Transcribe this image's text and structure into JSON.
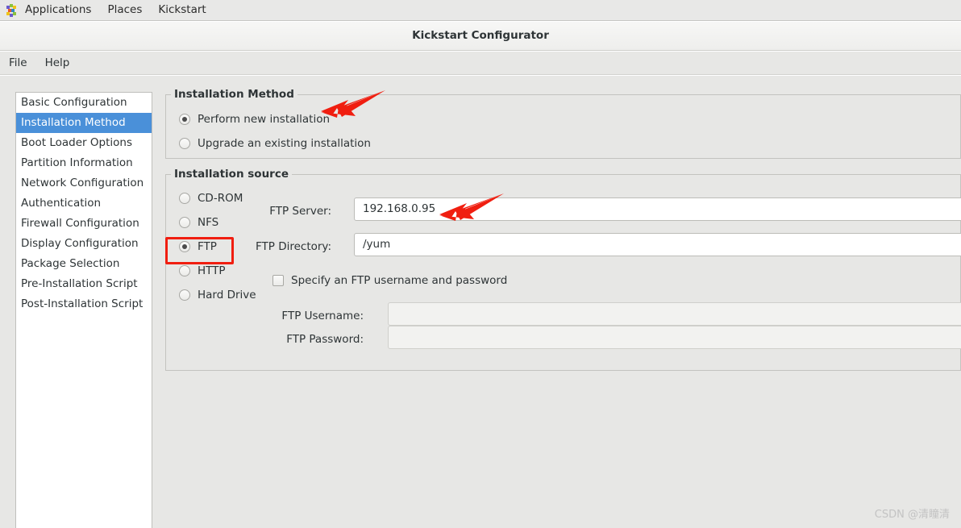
{
  "gnome_panel": {
    "logo_icon": "fedora-activities-icon",
    "items": [
      {
        "label": "Applications",
        "name": "panel-applications"
      },
      {
        "label": "Places",
        "name": "panel-places"
      },
      {
        "label": "Kickstart",
        "name": "panel-kickstart"
      }
    ]
  },
  "window": {
    "title": "Kickstart Configurator"
  },
  "menubar": {
    "items": [
      {
        "label": "File",
        "name": "menu-file"
      },
      {
        "label": "Help",
        "name": "menu-help"
      }
    ]
  },
  "sidebar": {
    "items": [
      {
        "label": "Basic Configuration",
        "selected": false
      },
      {
        "label": "Installation Method",
        "selected": true
      },
      {
        "label": "Boot Loader Options",
        "selected": false
      },
      {
        "label": "Partition Information",
        "selected": false
      },
      {
        "label": "Network Configuration",
        "selected": false
      },
      {
        "label": "Authentication",
        "selected": false
      },
      {
        "label": "Firewall Configuration",
        "selected": false
      },
      {
        "label": "Display Configuration",
        "selected": false
      },
      {
        "label": "Package Selection",
        "selected": false
      },
      {
        "label": "Pre-Installation Script",
        "selected": false
      },
      {
        "label": "Post-Installation Script",
        "selected": false
      }
    ]
  },
  "installation_method": {
    "group_title": "Installation Method",
    "options": [
      {
        "label": "Perform new installation",
        "checked": true
      },
      {
        "label": "Upgrade an existing installation",
        "checked": false
      }
    ]
  },
  "installation_source": {
    "group_title": "Installation source",
    "options": [
      {
        "label": "CD-ROM",
        "checked": false
      },
      {
        "label": "NFS",
        "checked": false
      },
      {
        "label": "FTP",
        "checked": true
      },
      {
        "label": "HTTP",
        "checked": false
      },
      {
        "label": "Hard Drive",
        "checked": false
      }
    ],
    "fields": [
      {
        "label": "FTP Server:",
        "value": "192.168.0.95",
        "placeholder": "",
        "disabled": false
      },
      {
        "label": "FTP Directory:",
        "value": "/yum",
        "placeholder": "",
        "disabled": false
      }
    ],
    "specify_credentials": {
      "label": "Specify an FTP username and password",
      "checked": false
    },
    "credential_fields": [
      {
        "label": "FTP Username:",
        "value": "",
        "placeholder": "",
        "disabled": true
      },
      {
        "label": "FTP Password:",
        "value": "",
        "placeholder": "",
        "disabled": true
      }
    ]
  },
  "annotations": {
    "highlight_box_target": "FTP",
    "arrow_color": "#f01e10",
    "arrows": [
      {
        "name": "arrow-to-perform-new-installation"
      },
      {
        "name": "arrow-to-ftp-server-field"
      }
    ]
  },
  "watermark": {
    "text": "CSDN @清瞳清"
  },
  "colors": {
    "selection_blue": "#4a90d9",
    "annotation_red": "#f01e10",
    "panel_gray": "#e7e7e5"
  }
}
